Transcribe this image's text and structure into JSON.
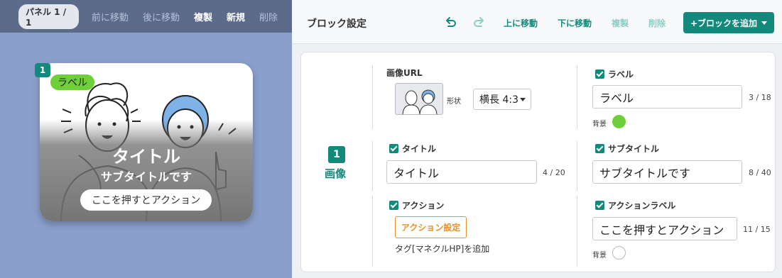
{
  "left_toolbar": {
    "panel_indicator": "パネル 1 / 1",
    "prev": "前に移動",
    "next": "後に移動",
    "duplicate": "複製",
    "new": "新規",
    "delete": "削除"
  },
  "preview_card": {
    "number": "1",
    "label": "ラベル",
    "title": "タイトル",
    "subtitle": "サブタイトルです",
    "action": "ここを押すとアクション"
  },
  "header": {
    "title": "ブロック設定",
    "undo_icon": "undo-icon",
    "redo_icon": "redo-icon",
    "move_up": "上に移動",
    "move_down": "下に移動",
    "duplicate": "複製",
    "delete": "削除",
    "add_block": "+ブロックを追加"
  },
  "block": {
    "number": "1",
    "type": "画像",
    "image_url": {
      "label": "画像URL",
      "shape_label": "形状",
      "shape_value": "横長 4:3"
    },
    "label_field": {
      "label": "ラベル",
      "checked": true,
      "value": "ラベル",
      "counter": "3 / 18",
      "bg_label": "背景",
      "bg_color": "#6fcf3a"
    },
    "title_field": {
      "label": "タイトル",
      "checked": true,
      "value": "タイトル",
      "counter": "4 / 20"
    },
    "subtitle_field": {
      "label": "サブタイトル",
      "checked": true,
      "value": "サブタイトルです",
      "counter": "8 / 40"
    },
    "action_field": {
      "label": "アクション",
      "checked": true,
      "button": "アクション設定",
      "note": "タグ[マネクルHP]を追加"
    },
    "action_label_field": {
      "label": "アクションラベル",
      "checked": true,
      "value": "ここを押すとアクション",
      "counter": "11 / 15",
      "bg_label": "背景",
      "bg_color": "#ffffff"
    }
  },
  "colors": {
    "accent": "#13897b",
    "label_green": "#6fcf3a",
    "action_orange": "#e8902a",
    "left_bg": "#8a9fcc",
    "left_toolbar": "#5c6b8a"
  }
}
